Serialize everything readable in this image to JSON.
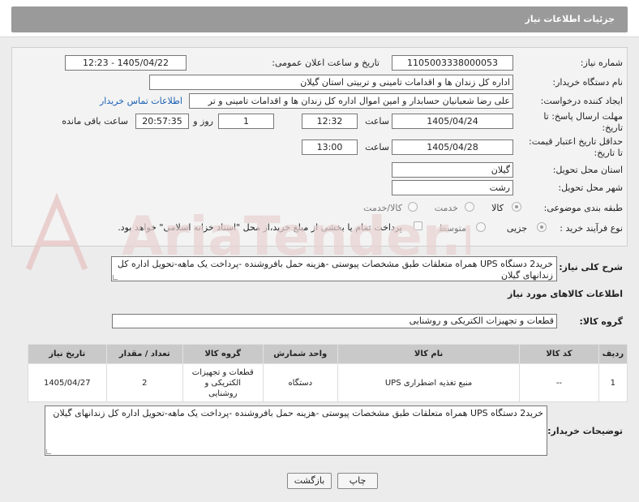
{
  "header": {
    "title": "جزئیات اطلاعات نیاز"
  },
  "form": {
    "need_number_label": "شماره نیاز:",
    "need_number": "1105003338000053",
    "announce_label": "تاریخ و ساعت اعلان عمومی:",
    "announce_value": "1405/04/22 - 12:23",
    "buyer_label": "نام دستگاه خریدار:",
    "buyer_value": "اداره کل زندان ها و اقدامات تامینی و تربیتی استان گیلان",
    "creator_label": "ایجاد کننده درخواست:",
    "creator_value": "علی رضا شعبانیان حسابدار و امین اموال اداره کل زندان ها و اقدامات تامینی و تر",
    "contact_link": "اطلاعات تماس خریدار",
    "deadline_label_1": "مهلت ارسال پاسخ: تا",
    "deadline_label_2": "تاریخ:",
    "deadline_date": "1405/04/24",
    "time_label": "ساعت",
    "deadline_time": "12:32",
    "days_value": "1",
    "days_label": "روز و",
    "remaining_time": "20:57:35",
    "remaining_label": "ساعت باقی مانده",
    "validity_label_1": "حداقل تاریخ اعتبار قیمت:",
    "validity_label_2": "تا تاریخ:",
    "validity_date": "1405/04/28",
    "validity_time": "13:00",
    "province_label": "استان محل تحویل:",
    "province_value": "گیلان",
    "city_label": "شهر محل تحویل:",
    "city_value": "رشت",
    "category_label": "طبقه بندی موضوعی:",
    "category_options": [
      "کالا",
      "خدمت",
      "کالا/خدمت"
    ],
    "category_selected": "کالا",
    "process_label": "نوع فرآیند خرید :",
    "process_options": [
      "جزیی",
      "متوسط"
    ],
    "process_selected": "جزیی",
    "payment_note": "پرداخت تمام یا بخشی از مبلغ خرید،از محل \"اسناد خزانه اسلامی\" خواهد بود."
  },
  "general_desc": {
    "label": "شرح کلی نیاز:",
    "value": "خرید2 دستگاه UPS  همراه متعلقات  طبق مشخصات پیوستی -هزینه حمل بافروشنده -پرداخت یک ماهه-تحویل اداره کل زندانهای گیلان"
  },
  "goods_info_title": "اطلاعات کالاهای مورد نیاز",
  "goods_group": {
    "label": "گروه کالا:",
    "value": "قطعات و تجهیزات الکتریکی و روشنایی"
  },
  "table": {
    "headers": [
      "ردیف",
      "کد کالا",
      "نام کالا",
      "واحد شمارش",
      "گروه کالا",
      "تعداد / مقدار",
      "تاریخ نیاز"
    ],
    "rows": [
      {
        "row": "1",
        "code": "--",
        "name": "منبع تغذیه اضطراری UPS",
        "unit": "دستگاه",
        "group": "قطعات و تجهیزات الکتریکی و روشنایی",
        "qty": "2",
        "date": "1405/04/27"
      }
    ]
  },
  "buyer_notes": {
    "label": "توضیحات خریدار:",
    "value": "خرید2 دستگاه UPS  همراه متعلقات  طبق مشخصات پیوستی -هزینه حمل بافروشنده -پرداخت یک ماهه-تحویل اداره کل زندانهای گیلان"
  },
  "buttons": {
    "print": "چاپ",
    "back": "بازگشت"
  },
  "watermark_text": "AriaTender.net"
}
